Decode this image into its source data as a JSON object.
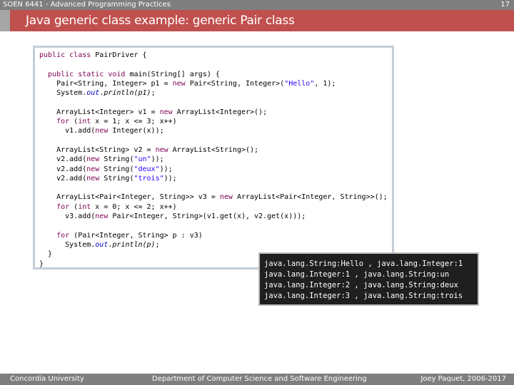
{
  "header": {
    "course": "SOEN 6441 - Advanced Programming Practices",
    "page_number": "17"
  },
  "slide": {
    "title": "Java generic class example: generic Pair class"
  },
  "code_lines": [
    "public class PairDriver {",
    "",
    "  public static void main(String[] args) {",
    "    Pair<String, Integer> p1 = new Pair<String, Integer>(\"Hello\", 1);",
    "    System.out.println(p1);",
    "",
    "    ArrayList<Integer> v1 = new ArrayList<Integer>();",
    "    for (int x = 1; x <= 3; x++)",
    "      v1.add(new Integer(x));",
    "",
    "    ArrayList<String> v2 = new ArrayList<String>();",
    "    v2.add(new String(\"un\"));",
    "    v2.add(new String(\"deux\"));",
    "    v2.add(new String(\"trois\"));",
    "",
    "    ArrayList<Pair<Integer, String>> v3 = new ArrayList<Pair<Integer, String>>();",
    "    for (int x = 0; x <= 2; x++)",
    "      v3.add(new Pair<Integer, String>(v1.get(x), v2.get(x)));",
    "",
    "    for (Pair<Integer, String> p : v3)",
    "      System.out.println(p);",
    "  }",
    "}"
  ],
  "console_output": [
    "java.lang.String:Hello , java.lang.Integer:1",
    "java.lang.Integer:1 , java.lang.String:un",
    "java.lang.Integer:2 , java.lang.String:deux",
    "java.lang.Integer:3 , java.lang.String:trois"
  ],
  "footer": {
    "left": "Concordia University",
    "center": "Department of Computer Science and Software Engineering",
    "right": "Joey Paquet, 2006-2017"
  },
  "colors": {
    "title_bar": "#c0504d",
    "chrome_gray": "#7f7f7f",
    "keyword": "#7f0055",
    "string_literal": "#2a00ff",
    "console_bg": "#1f1f1f"
  }
}
